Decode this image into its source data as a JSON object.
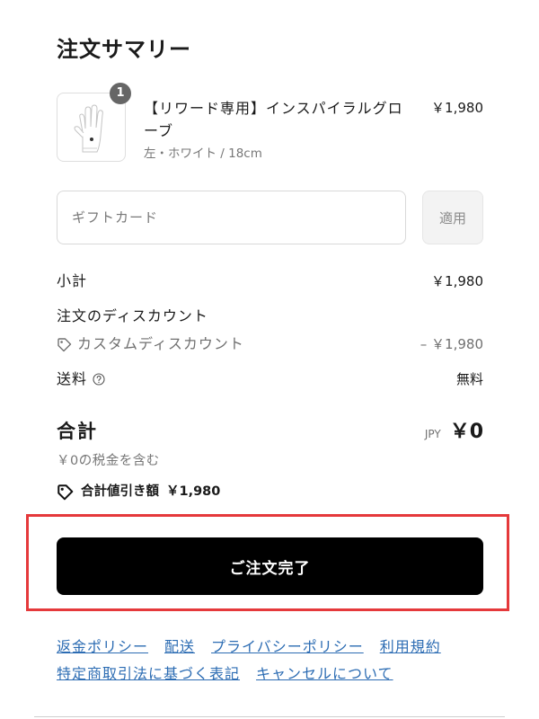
{
  "summary": {
    "title": "注文サマリー"
  },
  "line_items": [
    {
      "quantity": "1",
      "name": "【リワード専用】インスパイラルグローブ",
      "variant": "左・ホワイト / 18cm",
      "price": "￥1,980",
      "thumbnail_icon": "glove-image"
    }
  ],
  "gift_card": {
    "placeholder": "ギフトカード",
    "value": "",
    "apply_label": "適用"
  },
  "totals": {
    "subtotal_label": "小計",
    "subtotal_value": "￥1,980",
    "discount_heading": "注文のディスカウント",
    "discount_icon": "tag-icon",
    "discount_name": "カスタムディスカウント",
    "discount_value": "– ￥1,980",
    "shipping_label": "送料",
    "shipping_help_icon": "question-circle-icon",
    "shipping_value": "無料",
    "total_label": "合計",
    "currency": "JPY",
    "total_value": "￥0",
    "tax_note": "￥0の税金を含む",
    "savings_icon": "tag-icon",
    "savings_label": "合計値引き額",
    "savings_value": "￥1,980"
  },
  "actions": {
    "complete_order_label": "ご注文完了"
  },
  "footer_links": [
    "返金ポリシー",
    "配送",
    "プライバシーポリシー",
    "利用規約",
    "特定商取引法に基づく表記",
    "キャンセルについて"
  ],
  "colors": {
    "primary_button": "#000000",
    "link": "#2c6cb3",
    "muted_text": "#707070",
    "highlight_outline": "#e5393b",
    "badge": "#666666"
  }
}
